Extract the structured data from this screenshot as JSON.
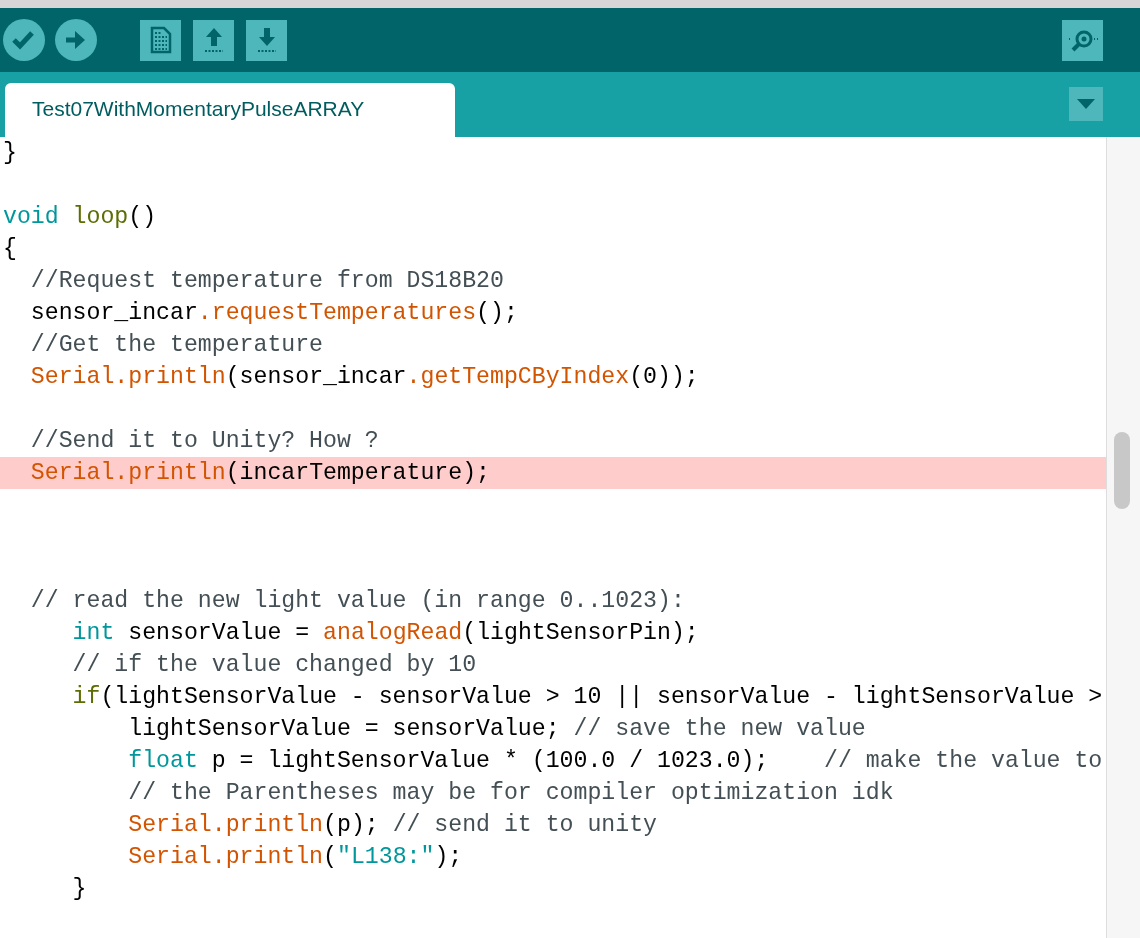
{
  "toolbar": {
    "buttons": [
      {
        "kind": "verify"
      },
      {
        "kind": "upload"
      },
      {
        "kind": "new"
      },
      {
        "kind": "open"
      },
      {
        "kind": "save"
      }
    ],
    "right_button": {
      "kind": "serial-monitor"
    }
  },
  "tabs": [
    {
      "label": "Test07WithMomentaryPulseARRAY",
      "selected": true
    }
  ],
  "tab_menu": {
    "kind": "dropdown"
  },
  "editor": {
    "lines": [
      {
        "highlighted": false,
        "tokens": [
          {
            "kind": "plain",
            "text": "}"
          }
        ]
      },
      {
        "highlighted": false,
        "kind": "blank"
      },
      {
        "highlighted": false,
        "tokens": [
          {
            "kind": "keyword",
            "text": "void "
          },
          {
            "kind": "control",
            "text": "loop"
          },
          {
            "kind": "plain",
            "text": "()"
          }
        ]
      },
      {
        "highlighted": false,
        "tokens": [
          {
            "kind": "plain",
            "text": "{"
          }
        ]
      },
      {
        "highlighted": false,
        "tokens": [
          {
            "kind": "comment",
            "text": "  //Request temperature from DS18B20"
          }
        ]
      },
      {
        "highlighted": false,
        "tokens": [
          {
            "kind": "plain",
            "text": "  sensor_incar"
          },
          {
            "kind": "function",
            "text": ".requestTemperatures"
          },
          {
            "kind": "plain",
            "text": "();"
          }
        ]
      },
      {
        "highlighted": false,
        "tokens": [
          {
            "kind": "comment",
            "text": "  //Get the temperature"
          }
        ]
      },
      {
        "highlighted": false,
        "tokens": [
          {
            "kind": "function",
            "text": "  Serial.println"
          },
          {
            "kind": "plain",
            "text": "(sensor_incar"
          },
          {
            "kind": "function",
            "text": ".getTempCByIndex"
          },
          {
            "kind": "plain",
            "text": "(0));"
          }
        ]
      },
      {
        "highlighted": false,
        "kind": "blank"
      },
      {
        "highlighted": false,
        "tokens": [
          {
            "kind": "comment",
            "text": "  //Send it to Unity? How ?"
          }
        ]
      },
      {
        "highlighted": true,
        "tokens": [
          {
            "kind": "function",
            "text": "  Serial.println"
          },
          {
            "kind": "plain",
            "text": "(incarTemperature);"
          }
        ]
      },
      {
        "highlighted": false,
        "kind": "blank"
      },
      {
        "highlighted": false,
        "kind": "blank"
      },
      {
        "highlighted": false,
        "kind": "blank"
      },
      {
        "highlighted": false,
        "tokens": [
          {
            "kind": "comment",
            "text": "  // read the new light value (in range 0..1023):"
          }
        ]
      },
      {
        "highlighted": false,
        "tokens": [
          {
            "kind": "keyword",
            "text": "     int"
          },
          {
            "kind": "plain",
            "text": " sensorValue = "
          },
          {
            "kind": "function",
            "text": "analogRead"
          },
          {
            "kind": "plain",
            "text": "(lightSensorPin);"
          }
        ]
      },
      {
        "highlighted": false,
        "tokens": [
          {
            "kind": "comment",
            "text": "     // if the value changed by 10"
          }
        ]
      },
      {
        "highlighted": false,
        "tokens": [
          {
            "kind": "control",
            "text": "     if"
          },
          {
            "kind": "plain",
            "text": "(lightSensorValue - sensorValue > 10 || sensorValue - lightSensorValue >"
          }
        ]
      },
      {
        "highlighted": false,
        "tokens": [
          {
            "kind": "plain",
            "text": "         lightSensorValue = sensorValue; "
          },
          {
            "kind": "comment",
            "text": "// save the new value"
          }
        ]
      },
      {
        "highlighted": false,
        "tokens": [
          {
            "kind": "keyword",
            "text": "         float"
          },
          {
            "kind": "plain",
            "text": " p = lightSensorValue * (100.0 / 1023.0);    "
          },
          {
            "kind": "comment",
            "text": "// make the value to"
          }
        ]
      },
      {
        "highlighted": false,
        "tokens": [
          {
            "kind": "comment",
            "text": "         // the Parentheses may be for compiler optimization idk"
          }
        ]
      },
      {
        "highlighted": false,
        "tokens": [
          {
            "kind": "function",
            "text": "         Serial.println"
          },
          {
            "kind": "plain",
            "text": "(p); "
          },
          {
            "kind": "comment",
            "text": "// send it to unity"
          }
        ]
      },
      {
        "highlighted": false,
        "tokens": [
          {
            "kind": "function",
            "text": "         Serial.println"
          },
          {
            "kind": "plain",
            "text": "("
          },
          {
            "kind": "string",
            "text": "\"L138:\""
          },
          {
            "kind": "plain",
            "text": ");"
          }
        ]
      },
      {
        "highlighted": false,
        "tokens": [
          {
            "kind": "plain",
            "text": "     }"
          }
        ]
      }
    ]
  }
}
